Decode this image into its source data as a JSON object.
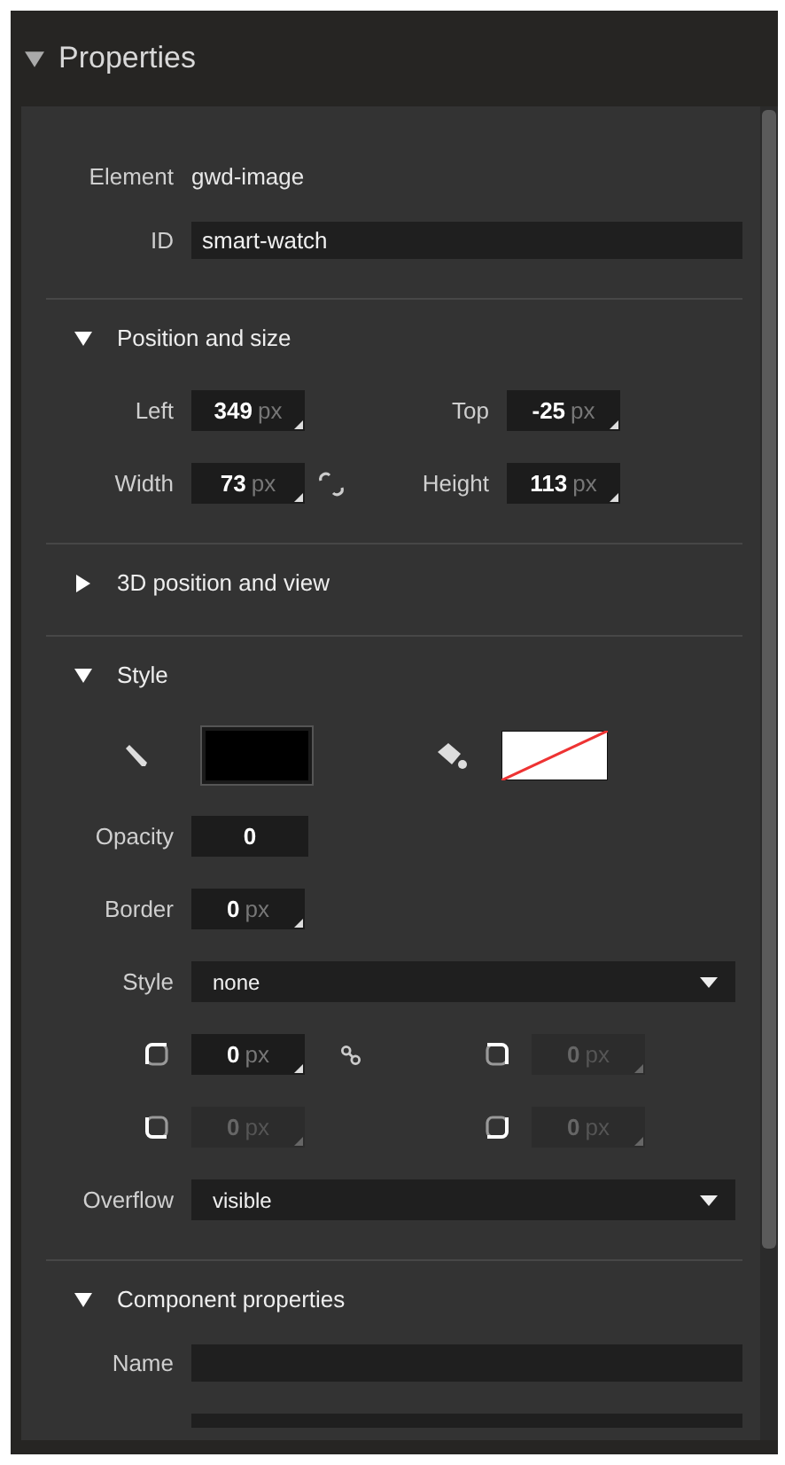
{
  "panel": {
    "title": "Properties",
    "expanded": true
  },
  "element": {
    "label": "Element",
    "value": "gwd-image"
  },
  "id_field": {
    "label": "ID",
    "value": "smart-watch"
  },
  "sections": [
    {
      "kind": "position",
      "title": "Position and size",
      "expanded": true,
      "linked": false,
      "fields": [
        {
          "label": "Left",
          "value": "349",
          "unit": "px"
        },
        {
          "label": "Top",
          "value": "-25",
          "unit": "px"
        },
        {
          "label": "Width",
          "value": "73",
          "unit": "px"
        },
        {
          "label": "Height",
          "value": "113",
          "unit": "px"
        }
      ]
    },
    {
      "kind": "plain",
      "title": "3D position and view",
      "expanded": false
    },
    {
      "kind": "style",
      "title": "Style",
      "expanded": true,
      "stroke": {
        "color": "#000000"
      },
      "fill": {
        "kind": "none"
      },
      "opacity": {
        "label": "Opacity",
        "value": "0"
      },
      "border": {
        "label": "Border",
        "value": "0",
        "unit": "px"
      },
      "border_style": {
        "label": "Style",
        "value": "none"
      },
      "radii": [
        {
          "kind": "top-left",
          "value": "0",
          "unit": "px",
          "disabled": false
        },
        {
          "kind": "top-right",
          "value": "0",
          "unit": "px",
          "disabled": true
        },
        {
          "kind": "bottom-left",
          "value": "0",
          "unit": "px",
          "disabled": true
        },
        {
          "kind": "bottom-right",
          "value": "0",
          "unit": "px",
          "disabled": true
        }
      ],
      "overflow": {
        "label": "Overflow",
        "value": "visible"
      }
    },
    {
      "kind": "component",
      "title": "Component properties",
      "expanded": true,
      "name_label": "Name"
    }
  ]
}
